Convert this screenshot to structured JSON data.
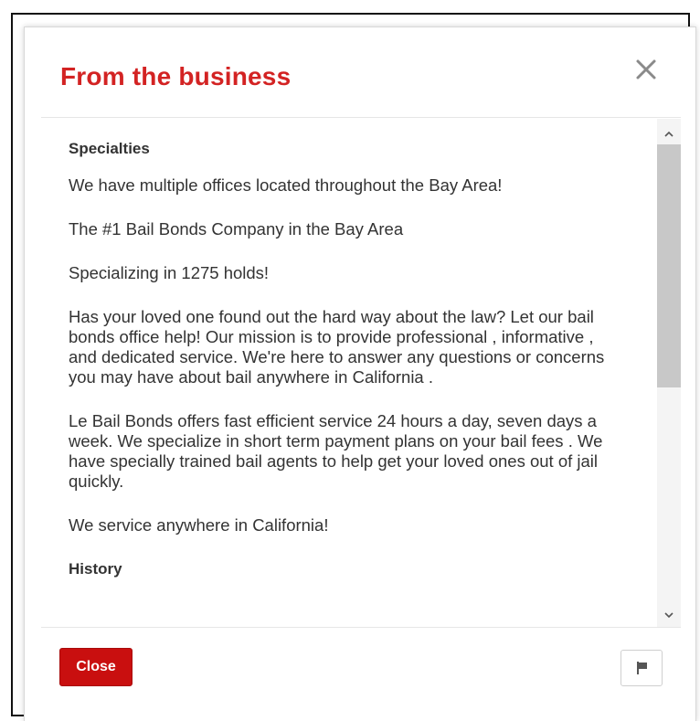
{
  "modal": {
    "title": "From the business"
  },
  "specialties": {
    "heading": "Specialties",
    "paragraphs": [
      "We have multiple offices located throughout the Bay Area!",
      "The #1 Bail Bonds Company in the Bay Area",
      "Specializing in 1275 holds!",
      "Has your loved one found out the hard way about the law? Let our bail bonds office help! Our mission is to provide professional , informative , and  dedicated service. We're here to answer any questions or concerns you may have about bail anywhere in California .",
      "Le Bail Bonds offers fast efficient service 24 hours a day, seven days a week. We specialize in short term payment plans on your bail fees . We have specially trained bail agents to help get your loved ones out of jail quickly.",
      "We service anywhere in California!"
    ]
  },
  "history": {
    "heading": "History"
  },
  "footer": {
    "close_label": "Close"
  },
  "icons": {
    "close": "close-icon",
    "flag": "flag-icon",
    "scroll_up": "chevron-up-icon",
    "scroll_down": "chevron-down-icon"
  },
  "colors": {
    "title": "#d32323",
    "close_button": "#c90f0f"
  }
}
